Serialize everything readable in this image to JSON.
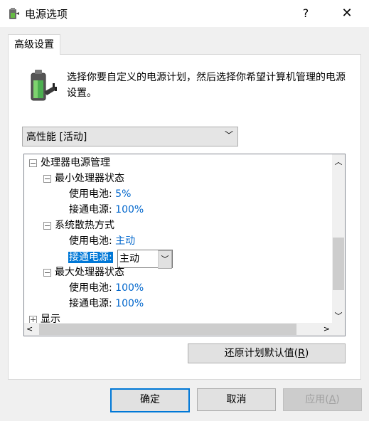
{
  "window": {
    "title": "电源选项",
    "help_label": "?",
    "close_label": "✕"
  },
  "tab": {
    "label": "高级设置"
  },
  "description": "选择你要自定义的电源计划，然后选择你希望计算机管理的电源设置。",
  "plan_select": {
    "value": "高性能 [活动]"
  },
  "tree": {
    "processor": {
      "label": "处理器电源管理",
      "min_state": {
        "label": "最小处理器状态",
        "battery_label": "使用电池:",
        "battery_value": "5%",
        "ac_label": "接通电源:",
        "ac_value": "100%"
      },
      "cooling": {
        "label": "系统散热方式",
        "battery_label": "使用电池:",
        "battery_value": "主动",
        "ac_label": "接通电源:",
        "ac_value": "主动"
      },
      "max_state": {
        "label": "最大处理器状态",
        "battery_label": "使用电池:",
        "battery_value": "100%",
        "ac_label": "接通电源:",
        "ac_value": "100%"
      }
    },
    "display": {
      "label": "显示"
    }
  },
  "restore_button": {
    "label": "还原计划默认值(",
    "key": "R",
    "suffix": ")"
  },
  "buttons": {
    "ok": "确定",
    "cancel": "取消",
    "apply_label": "应用(",
    "apply_key": "A",
    "apply_suffix": ")"
  },
  "colors": {
    "accent": "#0078d7",
    "value_blue": "#0066cc",
    "battery_green": "#4caf50"
  },
  "icons": {
    "app": "power-options-icon",
    "battery": "battery-plug-icon",
    "chevron": "chevron-down-icon"
  }
}
